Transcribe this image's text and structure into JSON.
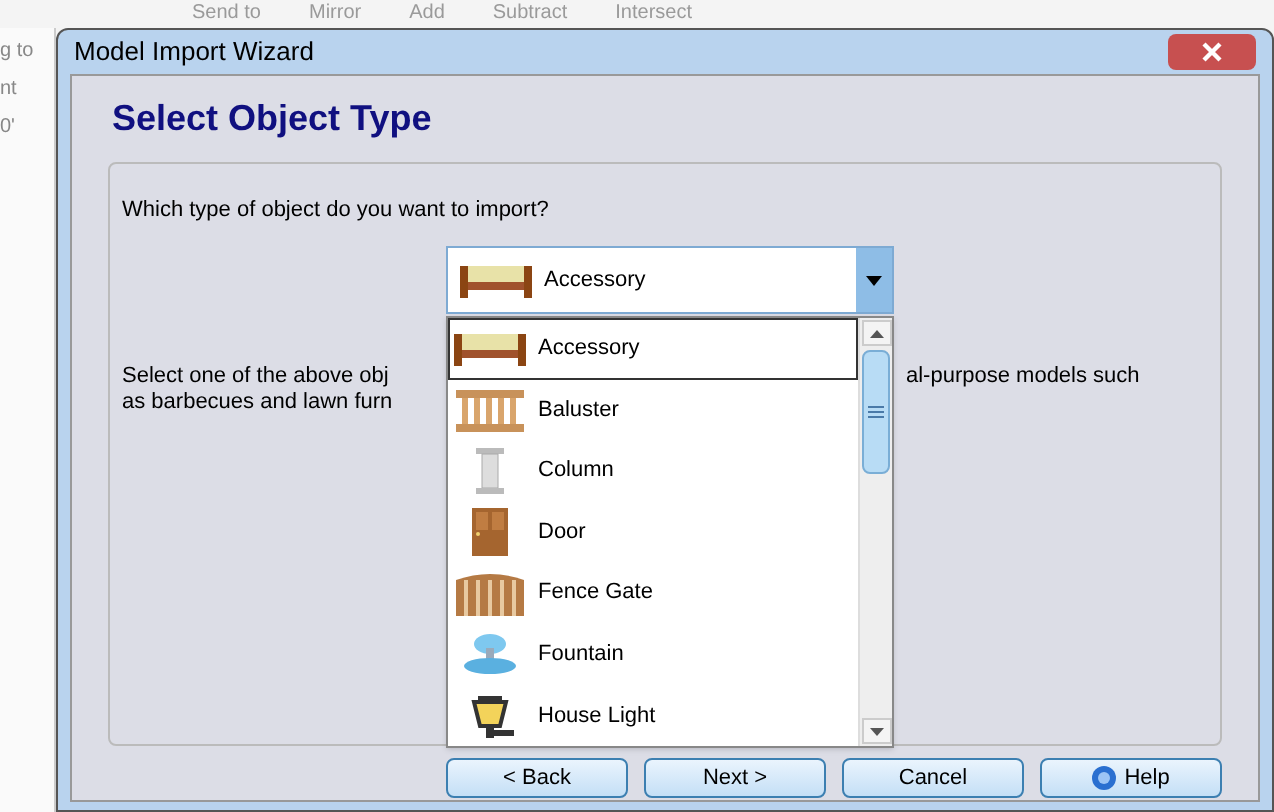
{
  "background_app": {
    "toolbar": [
      "Send to",
      "Mirror",
      "Add",
      "Subtract",
      "Intersect"
    ],
    "side_texts": [
      "g to",
      "nt",
      "0'"
    ]
  },
  "window": {
    "title": "Model Import Wizard",
    "heading": "Select Object Type"
  },
  "question": "Which type of object do you want to import?",
  "combo": {
    "value": "Accessory",
    "kind": "sofa"
  },
  "description_left": "Select one of the above obj\nas barbecues and lawn furn",
  "description_right": "al-purpose models such",
  "dropdown": [
    {
      "label": "Accessory",
      "kind": "sofa",
      "selected": true
    },
    {
      "label": "Baluster",
      "kind": "baluster",
      "selected": false
    },
    {
      "label": "Column",
      "kind": "column",
      "selected": false
    },
    {
      "label": "Door",
      "kind": "door",
      "selected": false
    },
    {
      "label": "Fence Gate",
      "kind": "gate",
      "selected": false
    },
    {
      "label": "Fountain",
      "kind": "fountain",
      "selected": false
    },
    {
      "label": "House Light",
      "kind": "lamp",
      "selected": false
    }
  ],
  "buttons": [
    {
      "label": "< Back",
      "kind": "plain"
    },
    {
      "label": "Next >",
      "kind": "plain"
    },
    {
      "label": "Cancel",
      "kind": "plain"
    },
    {
      "label": "Help",
      "kind": "help"
    }
  ]
}
